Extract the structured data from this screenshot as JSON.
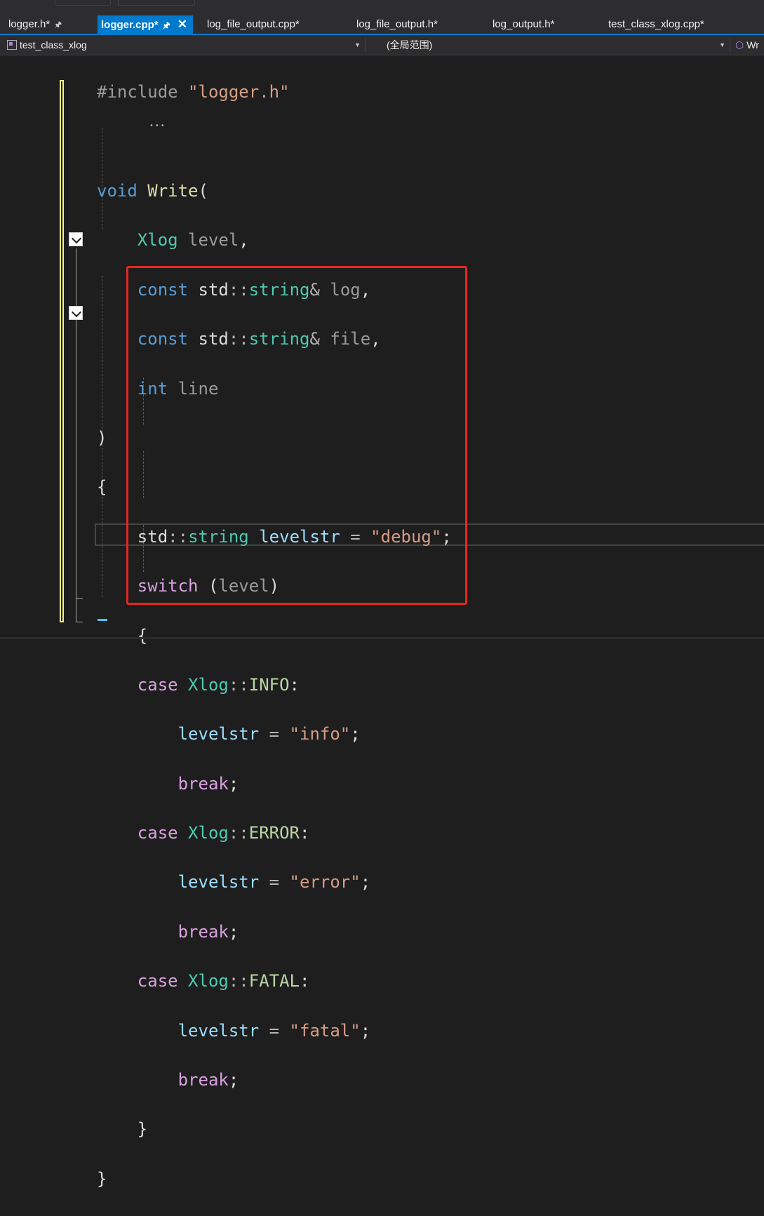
{
  "tabs": [
    {
      "label": "logger.h*",
      "pinned": true,
      "active": false
    },
    {
      "label": "logger.cpp*",
      "pinned": true,
      "active": true
    },
    {
      "label": "log_file_output.cpp*",
      "pinned": false,
      "active": false
    },
    {
      "label": "log_file_output.h*",
      "pinned": false,
      "active": false
    },
    {
      "label": "log_output.h*",
      "pinned": false,
      "active": false
    },
    {
      "label": "test_class_xlog.cpp*",
      "pinned": false,
      "active": false
    }
  ],
  "navbar": {
    "project": "test_class_xlog",
    "scope": "(全局范围)",
    "member": "Wr"
  },
  "icons": {
    "pin": "pin-icon",
    "close": "close-icon",
    "dropdown": "chevron-down-icon",
    "member": "cube-icon",
    "fold": "collapse-icon"
  },
  "code": {
    "include_directive": "#include",
    "include_file": "\"logger.h\"",
    "void_kw": "void",
    "func_name": "Write",
    "xlog_type": "Xlog",
    "param_level": "level",
    "const_kw": "const",
    "std_ns": "std",
    "string_type": "string",
    "param_log": "log",
    "param_file": "file",
    "int_kw": "int",
    "param_line": "line",
    "var_levelstr": "levelstr",
    "str_debug": "\"debug\"",
    "switch_kw": "switch",
    "case_kw": "case",
    "break_kw": "break",
    "enum_info": "INFO",
    "enum_error": "ERROR",
    "enum_fatal": "FATAL",
    "str_info": "\"info\"",
    "str_error": "\"error\"",
    "str_fatal": "\"fatal\""
  },
  "colors": {
    "keyword": "#569cd6",
    "control_keyword": "#d8a0df",
    "type": "#4ec9b0",
    "string": "#d69d85",
    "function": "#dcdcaa",
    "variable": "#9cdcfe",
    "highlight_box": "#e8261f",
    "active_tab": "#007acc"
  }
}
